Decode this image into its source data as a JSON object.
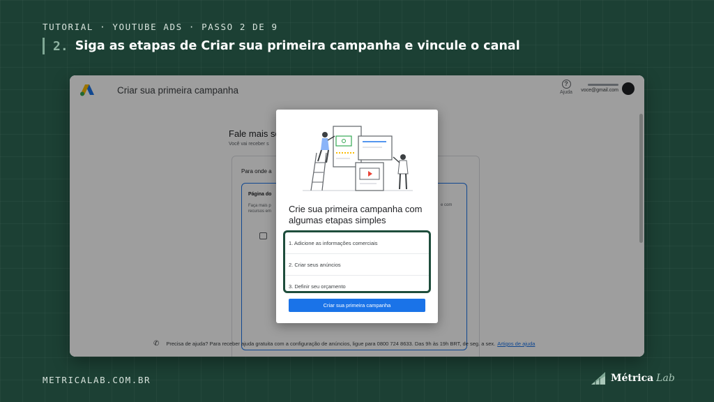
{
  "slide": {
    "eyebrow": "TUTORIAL · YOUTUBE ADS · PASSO 2 DE 9",
    "step_number": "2.",
    "headline": "Siga as etapas de Criar sua primeira campanha e vincule o canal",
    "website": "METRICALAB.COM.BR",
    "brand_main": "Métrica",
    "brand_accent": "Lab"
  },
  "app": {
    "title": "Criar sua primeira campanha",
    "help_label": "Ajuda",
    "help_icon": "question-circle-icon",
    "account_email": "voce@gmail.com",
    "background": {
      "heading": "Fale mais so",
      "subheading": "Você vai receber s",
      "card_title": "Para onde a",
      "option_title": "Página do",
      "option_desc": "Faça mais p recursos em",
      "option_desc_right": "e com"
    },
    "footer": {
      "text": "Precisa de ajuda? Para receber ajuda gratuita com a configuração de anúncios, ligue para 0800 724 8633. Das 9h às 19h BRT, de seg. a sex.",
      "link": "Artigos de ajuda"
    }
  },
  "modal": {
    "title": "Crie sua primeira campanha com algumas etapas simples",
    "steps": [
      "1. Adicione as informações comerciais",
      "2. Criar seus anúncios",
      "3. Definir seu orçamento"
    ],
    "cta_label": "Criar sua primeira campanha"
  },
  "colors": {
    "slide_bg": "#1c4034",
    "highlight_border": "#1e4d3c",
    "primary_blue": "#1a73e8"
  }
}
